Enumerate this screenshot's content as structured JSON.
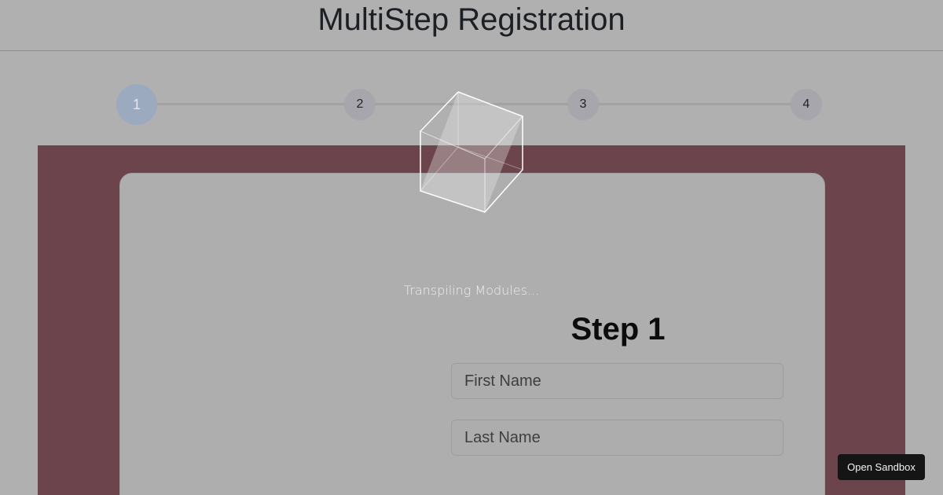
{
  "header": {
    "title": "MultiStep Registration"
  },
  "stepper": {
    "steps": [
      "1",
      "2",
      "3",
      "4"
    ],
    "active_step": 1
  },
  "form": {
    "step_title": "Step 1",
    "first_name_placeholder": "First Name",
    "last_name_placeholder": "Last Name"
  },
  "loader": {
    "text": "Transpiling Modules...",
    "icon": "cube-icon"
  },
  "sandbox": {
    "label": "Open Sandbox"
  },
  "colors": {
    "overlay": "#b0b0b0",
    "stage": "#6b444c",
    "active_step": "#9caac0",
    "button_bg": "#151515"
  }
}
